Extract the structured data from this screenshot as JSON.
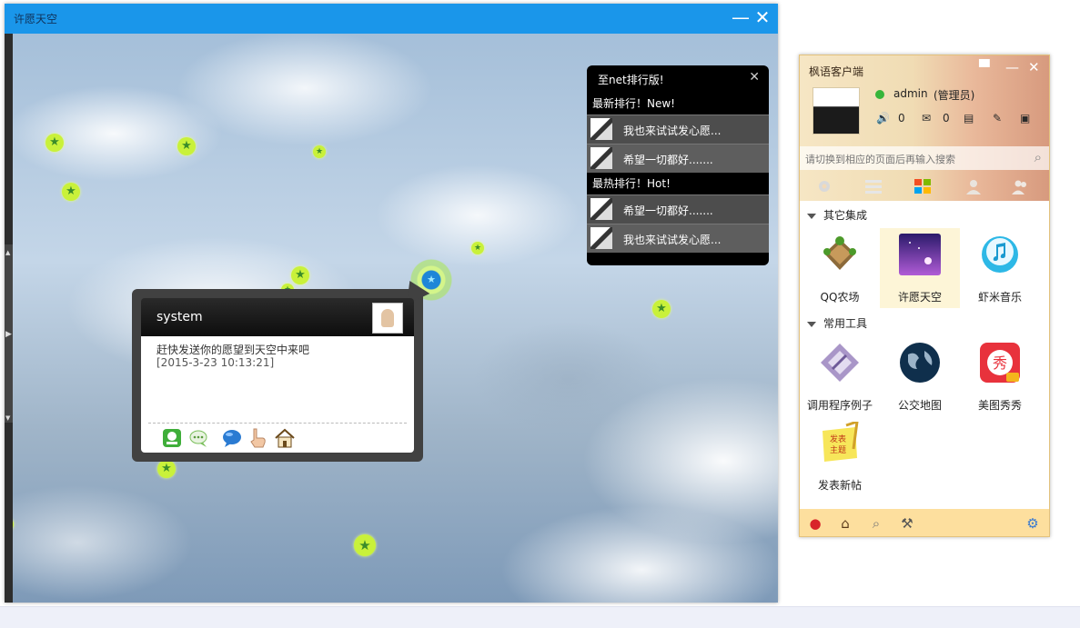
{
  "wish_window": {
    "title": "许愿天空",
    "minimize_glyph": "—",
    "close_glyph": "✕",
    "ranking": {
      "title": "至net排行版!",
      "close_glyph": "✕",
      "newest_label": "最新排行！New!",
      "newest": [
        "我也来试试发心愿...",
        "希望一切都好......."
      ],
      "hottest_label": "最热排行！Hot!",
      "hottest": [
        "希望一切都好.......",
        "我也来试试发心愿..."
      ]
    },
    "bubble": {
      "name": "system",
      "message": "赶快发送你的愿望到天空中来吧",
      "time": "[2015-3-23 10:13:21]",
      "icons": [
        "green-reply-icon",
        "chat-bubble-icon",
        "blue-bubble-icon",
        "hand-pointer-icon",
        "home-icon"
      ]
    }
  },
  "client": {
    "title": "枫语客户端",
    "username": "admin",
    "status": "(管理员)",
    "speaker_count": "0",
    "mail_count": "0",
    "search_placeholder": "请切换到相应的页面后再输入搜索",
    "groups": [
      {
        "label": "其它集成",
        "apps": [
          "QQ农场",
          "许愿天空",
          "虾米音乐"
        ],
        "selected": "许愿天空"
      },
      {
        "label": "常用工具",
        "apps": [
          "调用程序例子",
          "公交地图",
          "美图秀秀",
          "发表新帖"
        ]
      }
    ]
  },
  "colors": {
    "title_bar": "#1a96ea",
    "client_bottom": "#fddf9e",
    "star": "#c9f13a"
  }
}
